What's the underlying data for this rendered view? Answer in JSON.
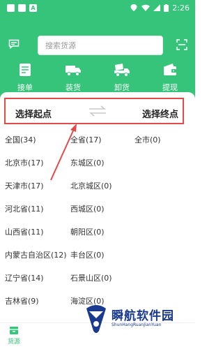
{
  "status_bar": {
    "time": "2:26"
  },
  "header": {
    "search_placeholder": "搜索货源"
  },
  "functions": [
    {
      "label": "接单",
      "icon": "order-icon"
    },
    {
      "label": "装货",
      "icon": "load-truck-icon"
    },
    {
      "label": "卸货",
      "icon": "unload-truck-icon"
    },
    {
      "label": "提现",
      "icon": "wallet-icon"
    }
  ],
  "route": {
    "start": "选择起点",
    "end": "选择终点"
  },
  "columns": {
    "provinces": [
      "全国(34)",
      "北京市(17)",
      "天津市(17)",
      "河北省(11)",
      "山西省(11)",
      "内蒙古自治区(12)",
      "辽宁省(14)",
      "吉林省(9)"
    ],
    "cities": [
      "全省(17)",
      "东城区(0)",
      "北京城区(0)",
      "西城区(0)",
      "朝阳区(0)",
      "丰台区(0)",
      "石景山区(0)",
      "海淀区(0)"
    ],
    "districts": [
      "全市(0)"
    ]
  },
  "bottom_nav": {
    "source_label": "货源"
  },
  "watermark": {
    "text": "瞬航软件园",
    "sub": "ShunHangRuanJianYuan"
  },
  "colors": {
    "accent": "#35c479",
    "highlight": "#e34a4a"
  }
}
